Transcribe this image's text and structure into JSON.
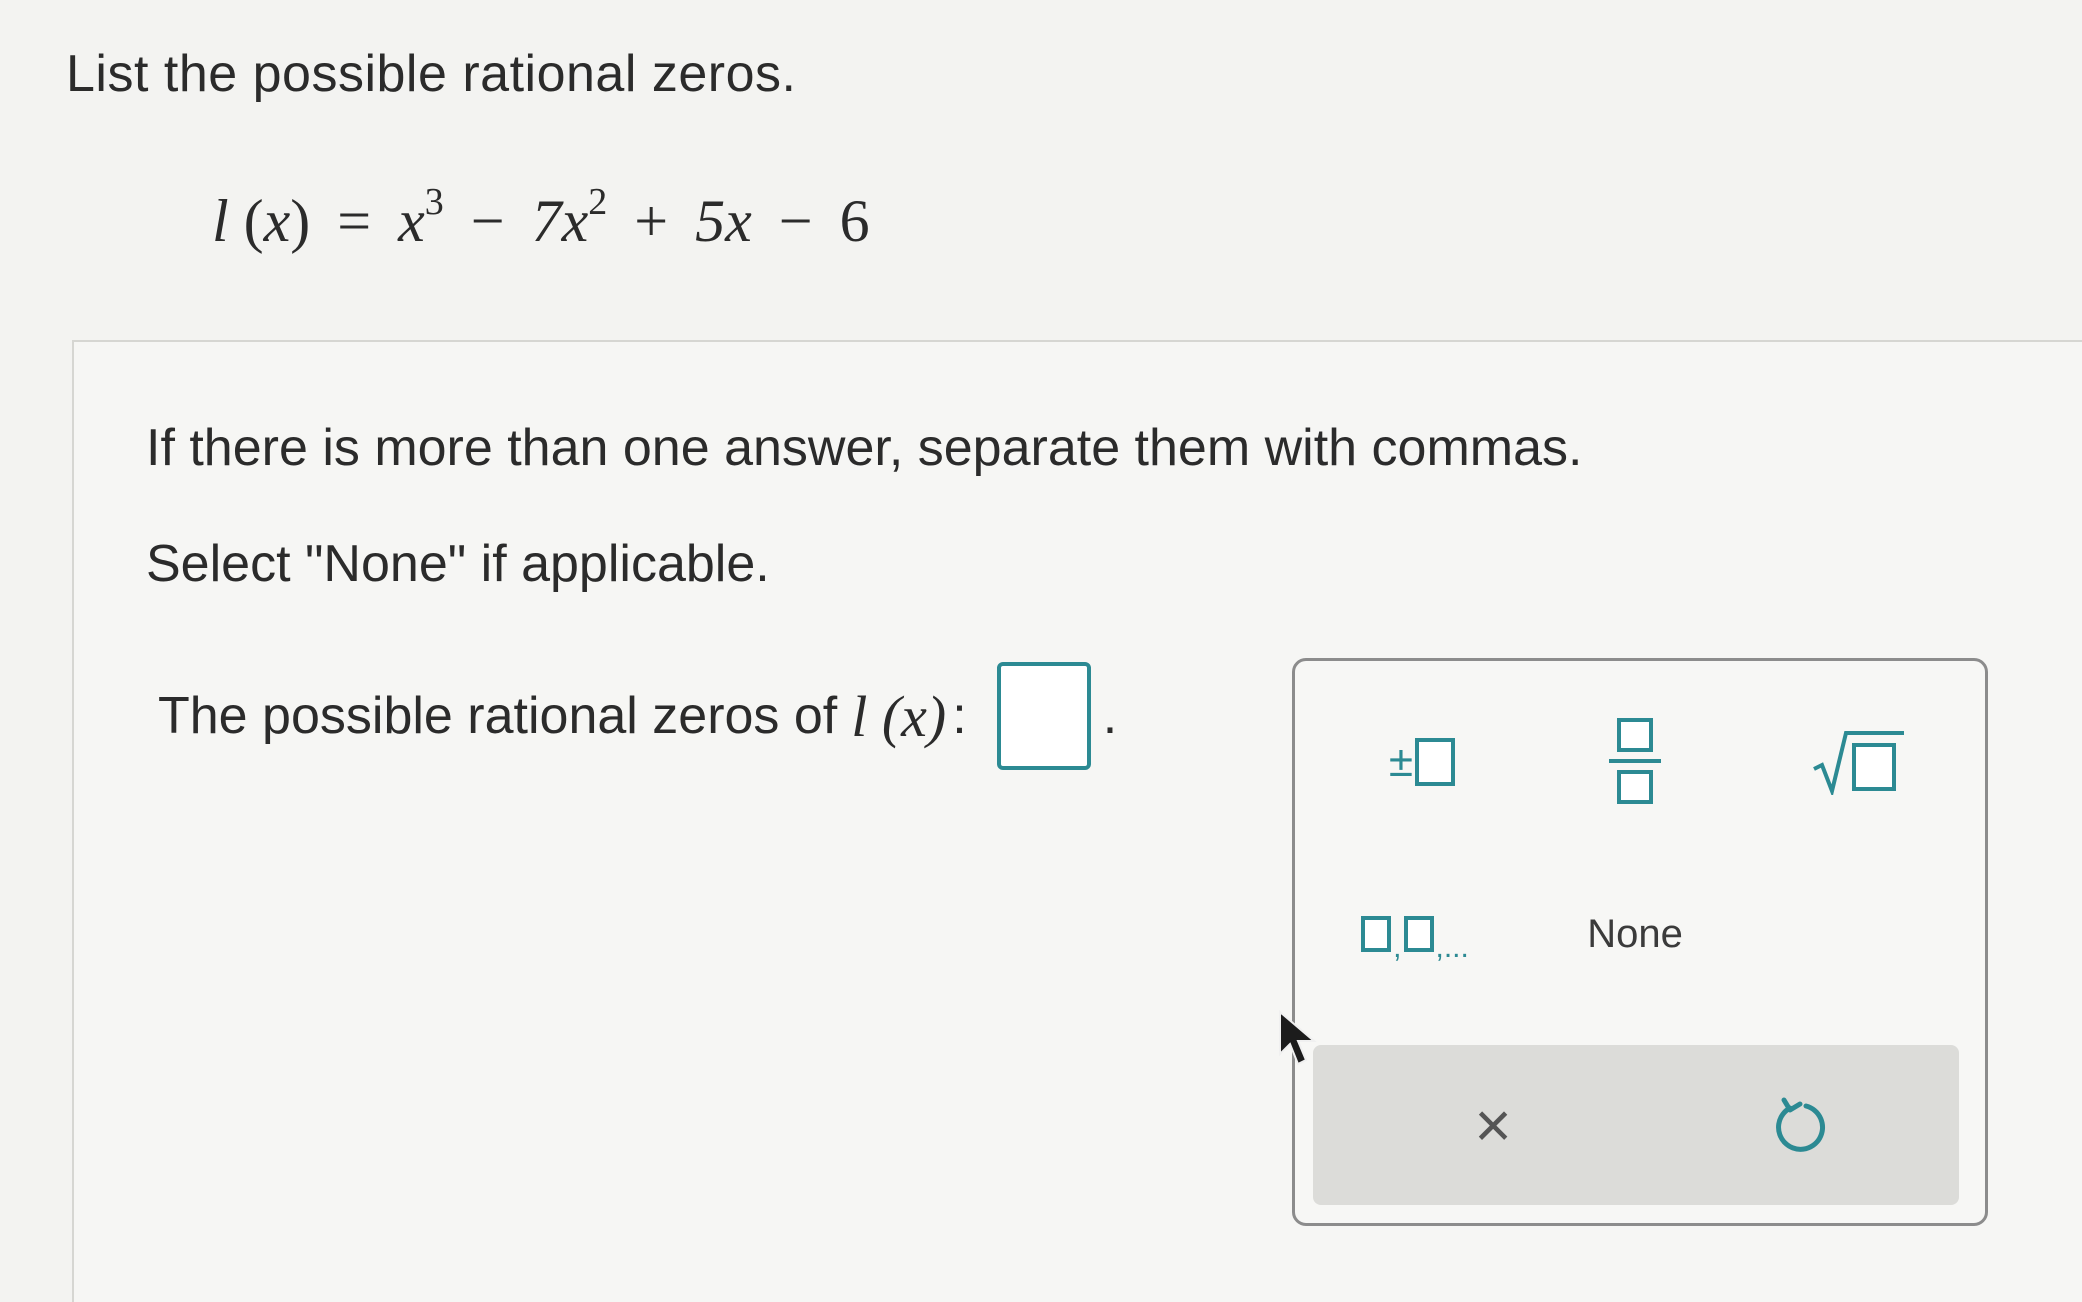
{
  "question": {
    "title": "List the possible rational zeros.",
    "equation": {
      "fn": "l",
      "var": "x",
      "terms": [
        "x",
        "3",
        "−",
        "7x",
        "2",
        "+",
        "5x",
        "−",
        "6"
      ]
    }
  },
  "instructions": {
    "line1": "If there is more than one answer, separate them with commas.",
    "line2": "Select \"None\" if applicable."
  },
  "prompt": {
    "label": "The possible rational zeros of",
    "fn": "l (x)",
    "colon": ":",
    "answer_value": "",
    "period": "."
  },
  "keypad": {
    "plusminus_symbol": "±",
    "list_separator": ",",
    "list_ellipsis": ",...",
    "none_label": "None",
    "clear_symbol": "×",
    "icons": [
      "plus-minus-template",
      "fraction-template",
      "square-root-template",
      "list-template",
      "clear-icon",
      "undo-icon"
    ]
  },
  "colors": {
    "accent": "#2c8a93",
    "text": "#2b2b2b",
    "action_bar": "#dcdcd9"
  }
}
